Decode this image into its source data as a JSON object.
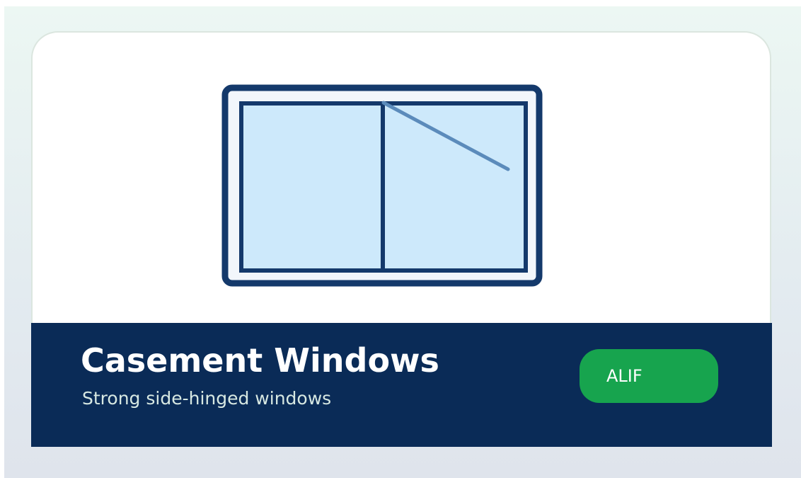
{
  "card": {
    "title": "Casement Windows",
    "subtitle": "Strong side-hinged windows",
    "button_label": "ALIF",
    "illustration_icon": "casement-window-icon"
  },
  "colors": {
    "background_top": "#ecf7f3",
    "background_bottom": "#dfe4ec",
    "footer": "#0a2b57",
    "button": "#17a44e",
    "frame": "#14396b",
    "glass": "#cde9fb",
    "hinge_line": "#5b8bbb"
  }
}
